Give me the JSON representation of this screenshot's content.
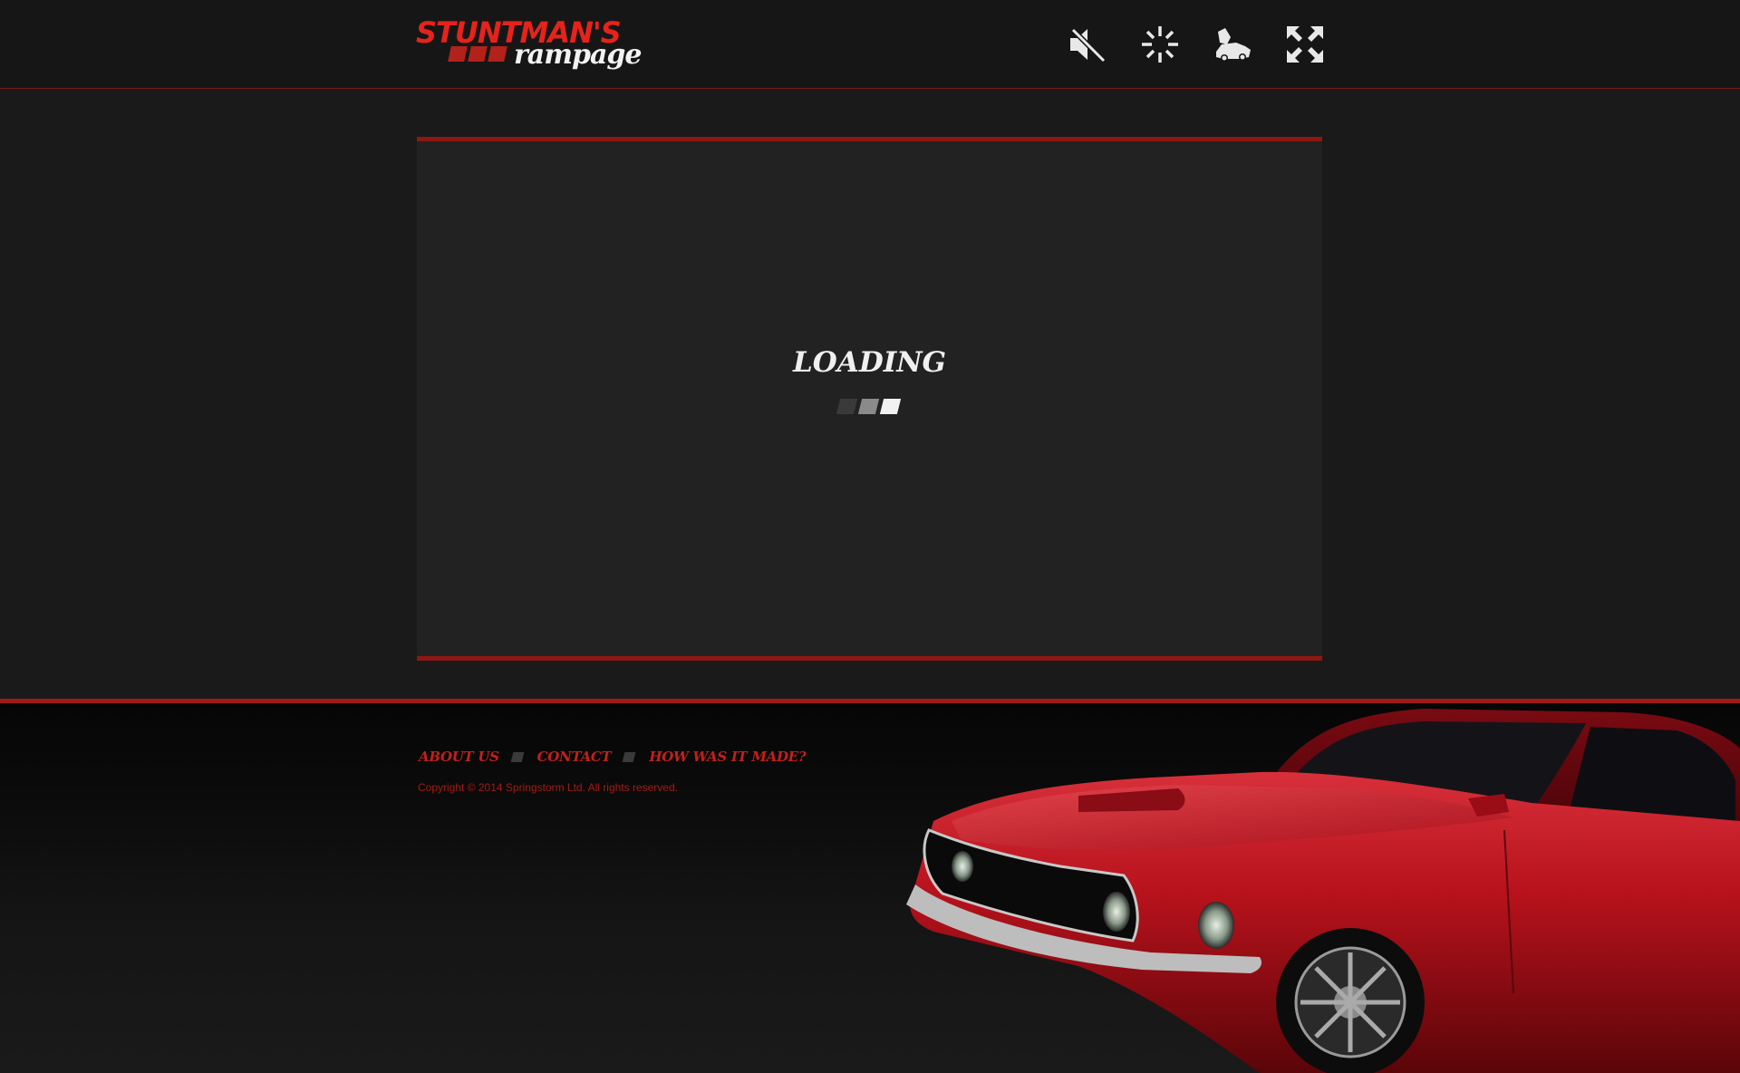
{
  "header": {
    "logo": {
      "line1": "STUNTMAN'S",
      "line2": "rampage"
    },
    "icons": [
      {
        "name": "mute-icon"
      },
      {
        "name": "loading-spinner-icon"
      },
      {
        "name": "car-crash-icon"
      },
      {
        "name": "fullscreen-icon"
      }
    ]
  },
  "game": {
    "loading_text": "LOADING",
    "loading_dots_colors": [
      "#3a3a3a",
      "#8a8a8a",
      "#f2f2f2"
    ]
  },
  "footer": {
    "links": [
      {
        "label": "ABOUT US"
      },
      {
        "label": "CONTACT"
      },
      {
        "label": "HOW WAS IT MADE?"
      }
    ],
    "copyright": "Copyright © 2014 Springstorm Ltd. All rights reserved."
  },
  "colors": {
    "accent_red": "#e5231b",
    "border_red": "#8e1712",
    "background": "#1a1a1a",
    "frame": "#222222"
  }
}
